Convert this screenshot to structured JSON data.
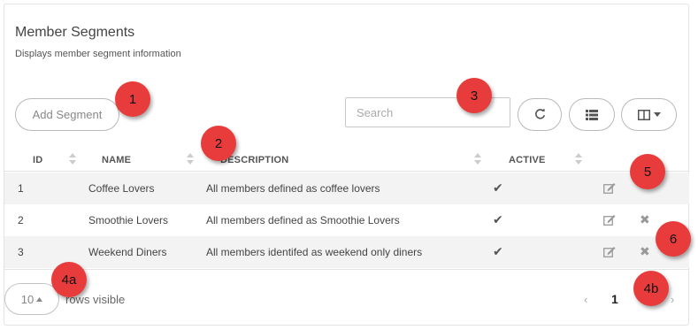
{
  "header": {
    "title": "Member Segments",
    "subtitle": "Displays member segment information"
  },
  "toolbar": {
    "add_label": "Add Segment",
    "search_placeholder": "Search",
    "refresh_icon": "refresh-icon",
    "list_icon": "list-icon",
    "columns_icon": "columns-icon"
  },
  "table": {
    "columns": [
      "ID",
      "NAME",
      "DESCRIPTION",
      "ACTIVE"
    ],
    "rows": [
      {
        "id": "1",
        "name": "Coffee Lovers",
        "description": "All members defined as coffee lovers",
        "active": "✔"
      },
      {
        "id": "2",
        "name": "Smoothie Lovers",
        "description": "All members defined as Smoothie Lovers",
        "active": "✔"
      },
      {
        "id": "3",
        "name": "Weekend Diners",
        "description": "All members identifed as weekend only diners",
        "active": "✔"
      }
    ],
    "delete_glyph": "✖"
  },
  "footer": {
    "page_size": "10",
    "rows_visible": "rows visible",
    "current_page": "1",
    "prev": "‹",
    "next": "›"
  },
  "callouts": [
    "1",
    "2",
    "3",
    "4a",
    "4b",
    "5",
    "6"
  ],
  "colors": {
    "callout": "#e83b3b",
    "alt_row": "#f3f3f3",
    "border": "#b9b9b9"
  }
}
